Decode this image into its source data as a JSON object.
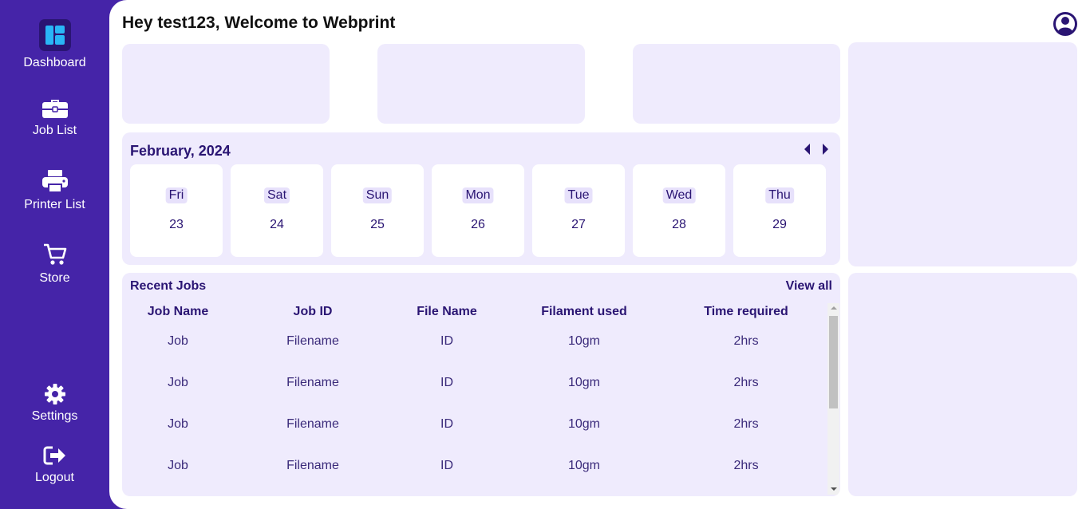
{
  "sidebar": {
    "items": [
      {
        "label": "Dashboard",
        "icon": "dashboard-icon"
      },
      {
        "label": "Job List",
        "icon": "briefcase-icon"
      },
      {
        "label": "Printer List",
        "icon": "printer-icon"
      },
      {
        "label": "Store",
        "icon": "cart-icon"
      },
      {
        "label": "Settings",
        "icon": "gear-icon"
      },
      {
        "label": "Logout",
        "icon": "logout-icon"
      }
    ]
  },
  "header": {
    "greeting": "Hey test123, Welcome to Webprint",
    "profile_icon": "user-circle-icon"
  },
  "calendar": {
    "month_label": "February, 2024",
    "days": [
      {
        "name": "Fri",
        "date": "23"
      },
      {
        "name": "Sat",
        "date": "24"
      },
      {
        "name": "Sun",
        "date": "25"
      },
      {
        "name": "Mon",
        "date": "26"
      },
      {
        "name": "Tue",
        "date": "27"
      },
      {
        "name": "Wed",
        "date": "28"
      },
      {
        "name": "Thu",
        "date": "29"
      }
    ]
  },
  "recent_jobs": {
    "title": "Recent Jobs",
    "view_all": "View all",
    "columns": [
      "Job Name",
      "Job ID",
      "File Name",
      "Filament used",
      "Time required"
    ],
    "rows": [
      [
        "Job",
        "Filename",
        "ID",
        "10gm",
        "2hrs"
      ],
      [
        "Job",
        "Filename",
        "ID",
        "10gm",
        "2hrs"
      ],
      [
        "Job",
        "Filename",
        "ID",
        "10gm",
        "2hrs"
      ],
      [
        "Job",
        "Filename",
        "ID",
        "10gm",
        "2hrs"
      ]
    ]
  },
  "colors": {
    "sidebar_bg": "#4524a8",
    "card_bg": "#efebfd",
    "accent_text": "#2a1573"
  }
}
